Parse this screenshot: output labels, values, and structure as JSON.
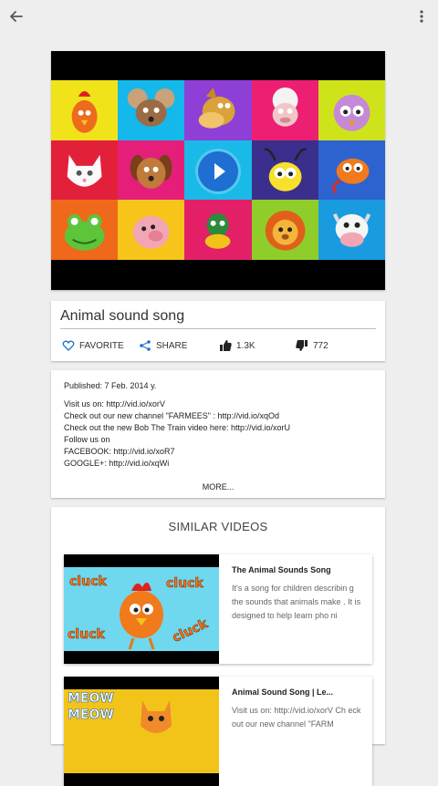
{
  "icons": {
    "back": "arrow-left-icon",
    "overflow": "more-vertical-icon",
    "play": "play-icon",
    "favorite": "heart-outline-icon",
    "share": "share-icon",
    "like": "thumb-up-icon",
    "dislike": "thumb-down-icon"
  },
  "video": {
    "title": "Animal sound song",
    "actions": {
      "favorite": "FAVORITE",
      "share": "SHARE",
      "likes": "1.3K",
      "dislikes": "772"
    },
    "published": "Published: 7 Feb. 2014 y.",
    "description_lines": [
      "Visit us on: http://vid.io/xorV",
      "Check out our new channel \"FARMEES\" : http://vid.io/xqOd",
      "Check out the new Bob The Train video here: http://vid.io/xorU",
      "Follow us on",
      "FACEBOOK: http://vid.io/xoR7",
      "GOOGLE+: http://vid.io/xqWi"
    ],
    "more_label": "MORE..."
  },
  "similar": {
    "heading": "SIMILAR VIDEOS",
    "items": [
      {
        "title": "The Animal Sounds Song",
        "description": "It's a song for children describin g the sounds that animals make . It is designed to help learn pho ni",
        "thumb_words": [
          "cluck",
          "cluck",
          "cluck",
          "cluck"
        ]
      },
      {
        "title": "Animal Sound Song | Le...",
        "description": "Visit us on: http://vid.io/xorV Ch eck out our new channel \"FARM",
        "thumb_words": [
          "MEOW",
          "MEOW"
        ]
      }
    ]
  }
}
